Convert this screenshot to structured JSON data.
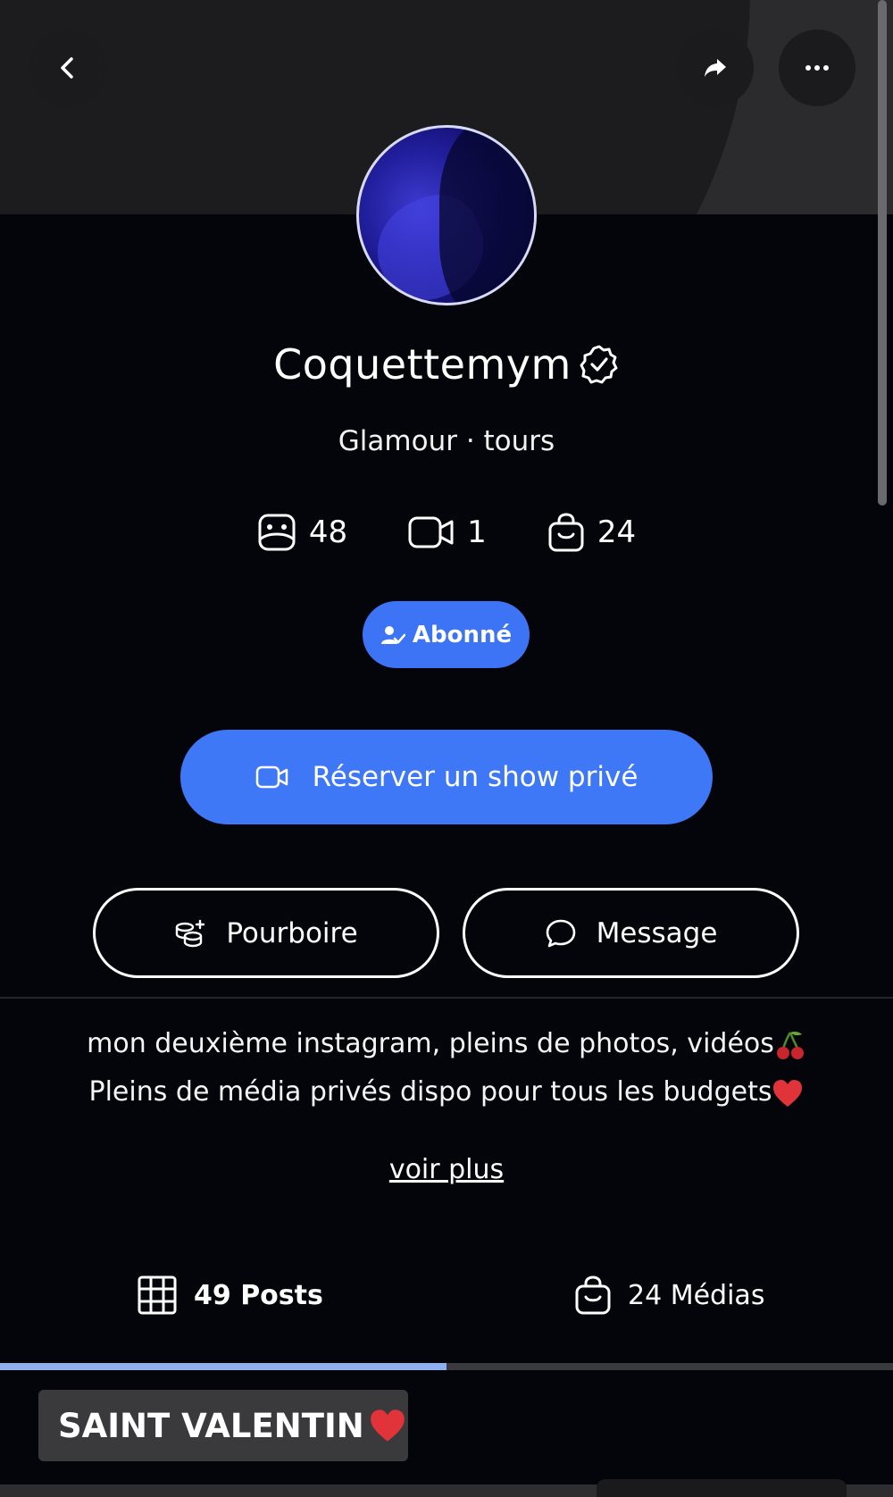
{
  "header": {
    "icons": {
      "back": "chevron-left-icon",
      "share": "share-arrow-icon",
      "more": "more-dots-icon"
    }
  },
  "profile": {
    "name": "Coquettemym",
    "tagline": "Glamour · tours",
    "stats": [
      {
        "icon": "photo-icon",
        "value": "48"
      },
      {
        "icon": "video-icon",
        "value": "1"
      },
      {
        "icon": "shop-bag-icon",
        "value": "24"
      }
    ]
  },
  "actions": {
    "follow_label": "Abonné",
    "reserve_label": "Réserver un show privé",
    "tip_label": "Pourboire",
    "message_label": "Message"
  },
  "bio": {
    "line1": "mon deuxième instagram, pleins de photos, vidéos",
    "line2": "Pleins de média privés dispo pour tous les budgets",
    "more_link": "voir plus"
  },
  "tabs": {
    "posts": "49 Posts",
    "media": "24 Médias",
    "active_fraction": 0.5
  },
  "chips": {
    "saint_valentin": "SAINT VALENTIN"
  },
  "colors": {
    "background": "#04050a",
    "accent": "#3d74f5",
    "banner": "#2b2b2d"
  }
}
